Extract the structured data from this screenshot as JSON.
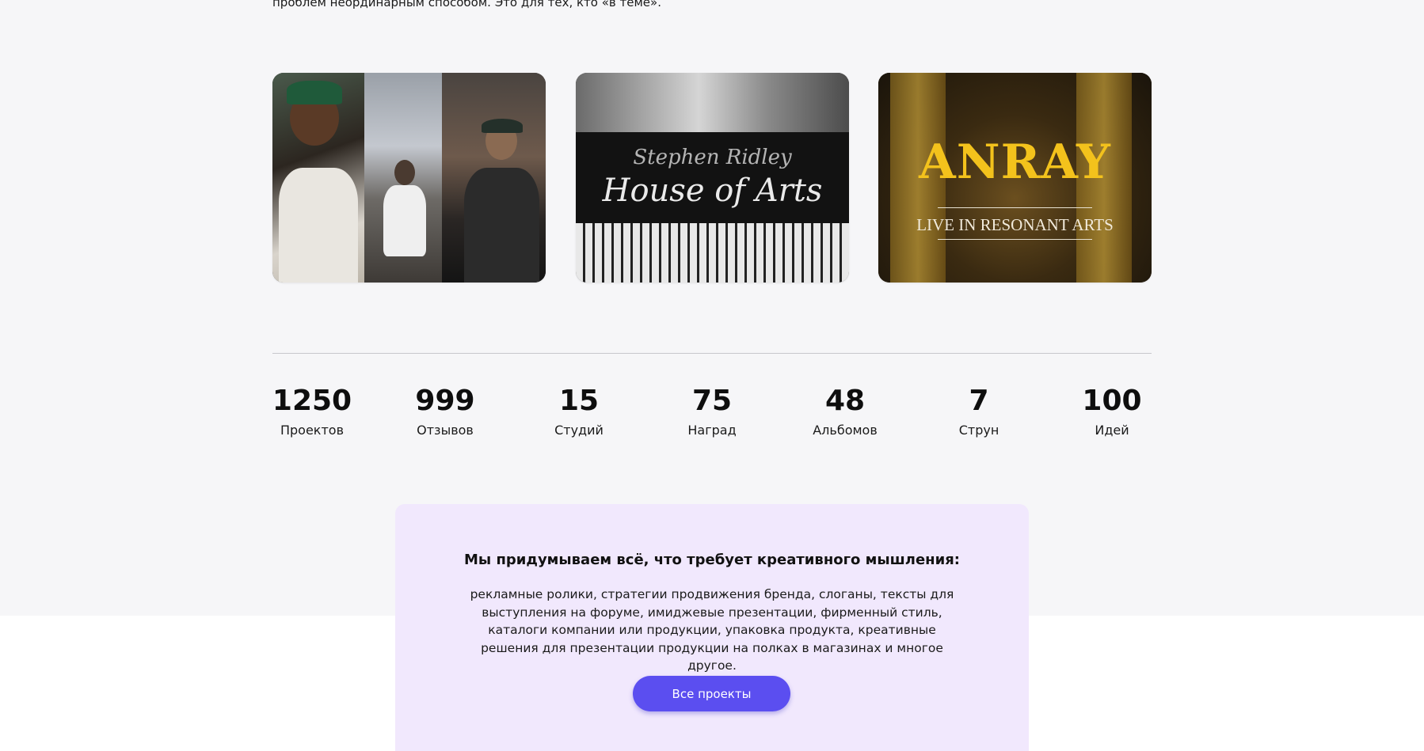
{
  "intro": {
    "text": "проблем неординарным способом. Это для тех, кто «в теме»."
  },
  "cards": [
    {
      "title": ""
    },
    {
      "script_small": "Stephen Ridley",
      "script_large": "House of Arts"
    },
    {
      "title": "ANRAY",
      "subtitle": "LIVE IN RESONANT ARTS"
    }
  ],
  "stats": [
    {
      "value": "1250",
      "label": "Проектов"
    },
    {
      "value": "999",
      "label": "Отзывов"
    },
    {
      "value": "15",
      "label": "Студий"
    },
    {
      "value": "75",
      "label": "Наград"
    },
    {
      "value": "48",
      "label": "Альбомов"
    },
    {
      "value": "7",
      "label": "Струн"
    },
    {
      "value": "100",
      "label": "Идей"
    }
  ],
  "cta": {
    "title": "Мы придумываем всё, что требует креативного мышления:",
    "body": "рекламные ролики, стратегии продвижения бренда, слоганы, тексты для выступления на форуме, имиджевые презентации, фирменный стиль, каталоги компании или продукции, упаковка продукта, креативные решения для презентации продукции на полках в магазинах и многое другое.",
    "button_label": "Все проекты"
  },
  "colors": {
    "accent": "#5b4ef0",
    "cta_background": "#f1e8fd",
    "page_background": "#f6f6f8",
    "anray_yellow": "#f3c21c"
  }
}
